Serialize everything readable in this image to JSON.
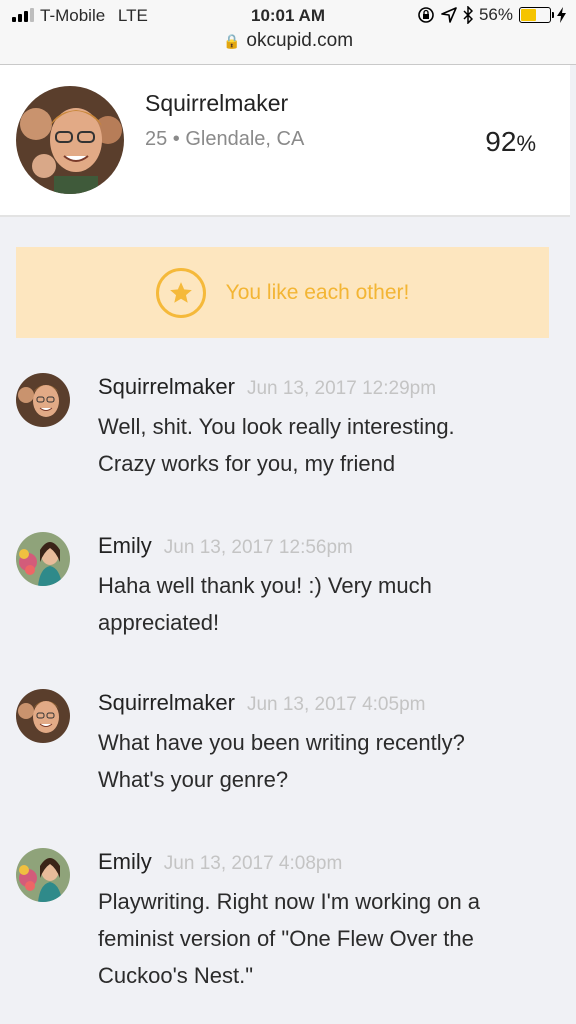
{
  "status_bar": {
    "carrier": "T-Mobile",
    "network": "LTE",
    "time": "10:01 AM",
    "battery_percent": "56%",
    "battery_level": 0.56
  },
  "browser": {
    "url": "okcupid.com"
  },
  "profile": {
    "username": "Squirrelmaker",
    "meta": "25 • Glendale, CA",
    "match_value": "92",
    "match_unit": "%"
  },
  "mutual_banner": {
    "text": "You like each other!"
  },
  "messages": [
    {
      "sender": "Squirrelmaker",
      "time": "Jun 13, 2017 12:29pm",
      "lines": [
        "Well, shit. You look really interesting.",
        "Crazy works for you, my friend"
      ]
    },
    {
      "sender": "Emily",
      "time": "Jun 13, 2017 12:56pm",
      "lines": [
        "Haha well thank you! :) Very much",
        "appreciated!"
      ]
    },
    {
      "sender": "Squirrelmaker",
      "time": "Jun 13, 2017 4:05pm",
      "lines": [
        "What have you been writing recently?",
        "What's your genre?"
      ]
    },
    {
      "sender": "Emily",
      "time": "Jun 13, 2017 4:08pm",
      "lines": [
        "Playwriting. Right now I'm working on a",
        "feminist version of \"One Flew Over the",
        "Cuckoo's Nest.\""
      ]
    }
  ],
  "colors": {
    "accent": "#f3b534",
    "banner_bg": "#fde6bf",
    "timestamp": "#c4c4c4"
  }
}
